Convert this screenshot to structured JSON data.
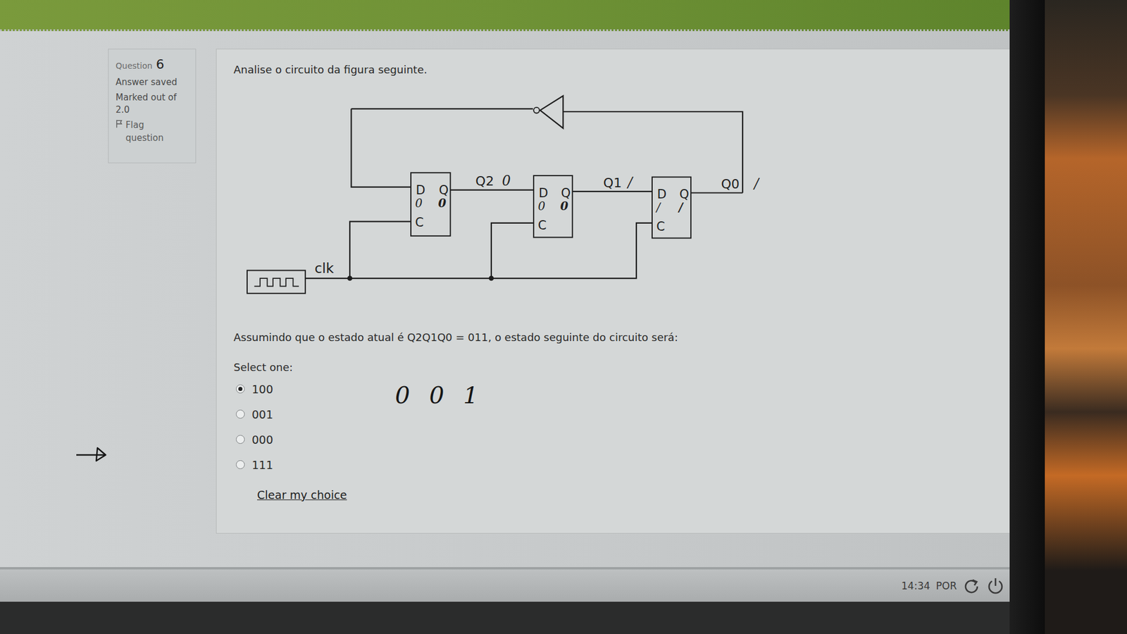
{
  "info": {
    "question_label": "Question",
    "question_number": "6",
    "status": "Answer saved",
    "marked": "Marked out of 2.0",
    "flag": "Flag question"
  },
  "question": {
    "intro": "Analise o circuito da figura seguinte.",
    "prompt": "Assumindo que o estado atual é Q2Q1Q0 = 011, o estado seguinte do circuito será:",
    "select_label": "Select one:",
    "options": [
      {
        "label": "100",
        "selected": true
      },
      {
        "label": "001",
        "selected": false
      },
      {
        "label": "000",
        "selected": false
      },
      {
        "label": "111",
        "selected": false
      }
    ],
    "clear": "Clear my choice"
  },
  "diagram": {
    "clock_label": "clk",
    "flipflops": [
      {
        "d": "D",
        "q": "Q",
        "c": "C",
        "output": "Q2",
        "note_d": "0",
        "note_q": "0",
        "note_out": "0"
      },
      {
        "d": "D",
        "q": "Q",
        "c": "C",
        "output": "Q1",
        "note_d": "0",
        "note_q": "0",
        "note_out": "/"
      },
      {
        "d": "D",
        "q": "Q",
        "c": "C",
        "output": "Q0",
        "note_d": "/",
        "note_q": "/",
        "note_out": "/"
      }
    ]
  },
  "handwriting": {
    "answer": "0 0 1"
  },
  "taskbar": {
    "time": "14:34",
    "language": "POR"
  }
}
